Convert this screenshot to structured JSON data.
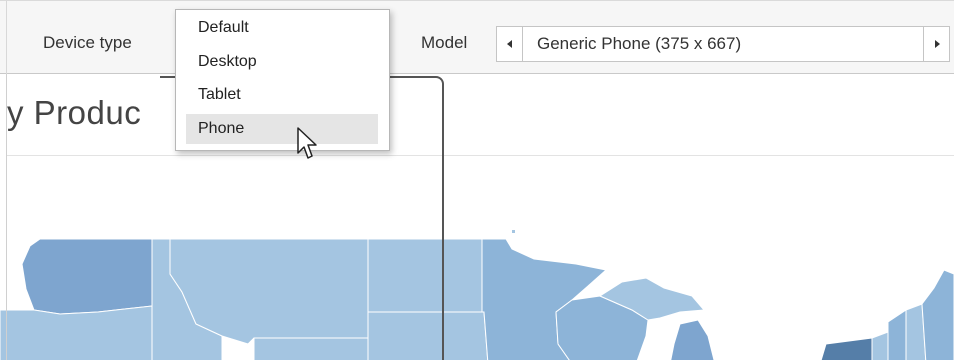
{
  "toolbar": {
    "device_type_label": "Device type",
    "model_label": "Model",
    "model_value": "Generic Phone (375 x 667)",
    "prev_icon": "caret-left-icon",
    "next_icon": "caret-right-icon"
  },
  "dropdown": {
    "items": [
      "Default",
      "Desktop",
      "Tablet",
      "Phone"
    ],
    "selected": "Phone"
  },
  "view": {
    "title": "y Produc"
  },
  "colors": {
    "map_light": "#a4c5e1",
    "map_medium": "#8db4d8",
    "map_dark": "#7ea5cf",
    "map_darkest": "#557ea8",
    "frame": "#555555",
    "selection": "#e5e5e5"
  }
}
